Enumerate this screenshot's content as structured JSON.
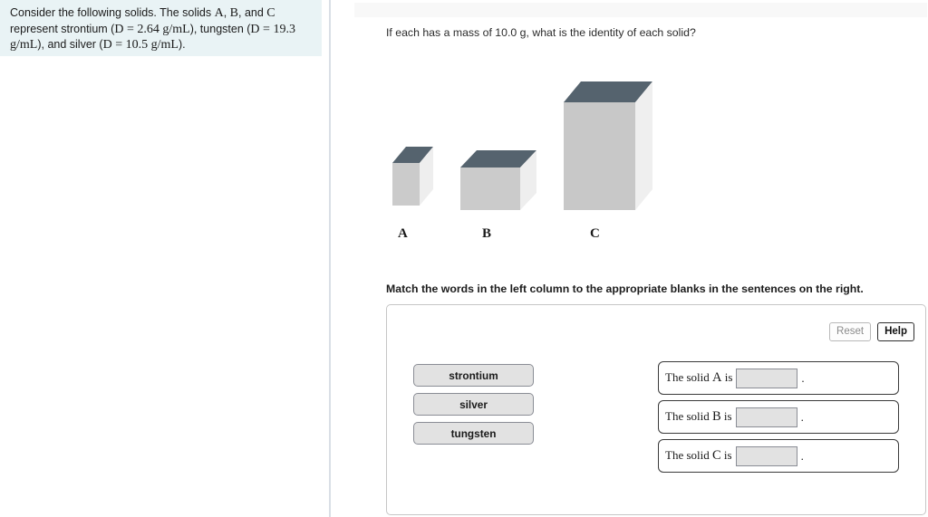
{
  "left_panel": {
    "statement_parts": {
      "p1": "Consider the following solids. The solids ",
      "a": "A",
      "comma1": ", ",
      "b": "B",
      "comma2": ", and ",
      "c": "C",
      "p2": " represent strontium (",
      "d1": "D",
      "eq1": " = ",
      "v1": "2.64",
      "u1": "g/mL",
      "p3": "), tungsten (",
      "d2": "D",
      "eq2": " = ",
      "v2": "19.3",
      "u2": "g/mL",
      "p4": "), and silver (",
      "d3": "D",
      "eq3": " = ",
      "v3": "10.5",
      "u3": "g/mL",
      "p5": ")."
    },
    "background_color": "#e9f3f5"
  },
  "right_panel": {
    "question": "If each has a mass of 10.0 g, what is the identity of each solid?",
    "match_instructions": "Match the words in the left column to the appropriate blanks in the sentences on the right."
  },
  "figure": {
    "solids": [
      {
        "label": "A",
        "face_color": "#cccccc",
        "top_color": "#55636e",
        "side_color": "#eeeeee"
      },
      {
        "label": "B",
        "face_color": "#cccccc",
        "top_color": "#55636e",
        "side_color": "#eeeeee"
      },
      {
        "label": "C",
        "face_color": "#c8c8c8",
        "top_color": "#55636e",
        "side_color": "#efefef"
      }
    ]
  },
  "exercise": {
    "toolbar": {
      "reset_label": "Reset",
      "help_label": "Help"
    },
    "word_bank": [
      {
        "label": "strontium"
      },
      {
        "label": "silver"
      },
      {
        "label": "tungsten"
      }
    ],
    "sentences": [
      {
        "prefix": "The solid ",
        "solid": "A",
        "suffix": " is",
        "answer": "",
        "period": "."
      },
      {
        "prefix": "The solid ",
        "solid": "B",
        "suffix": " is",
        "answer": "",
        "period": "."
      },
      {
        "prefix": "The solid ",
        "solid": "C",
        "suffix": " is",
        "answer": "",
        "period": "."
      }
    ]
  },
  "colors": {
    "panel_tint": "#e9f3f5",
    "divider": "#d9dfe6",
    "solid_top": "#55636e",
    "solid_front": "#cccccc",
    "solid_side": "#eeeeee",
    "chip_fill": "#e2e2e2",
    "chip_border": "#8a8d95",
    "row_border": "#3a3a3a"
  }
}
